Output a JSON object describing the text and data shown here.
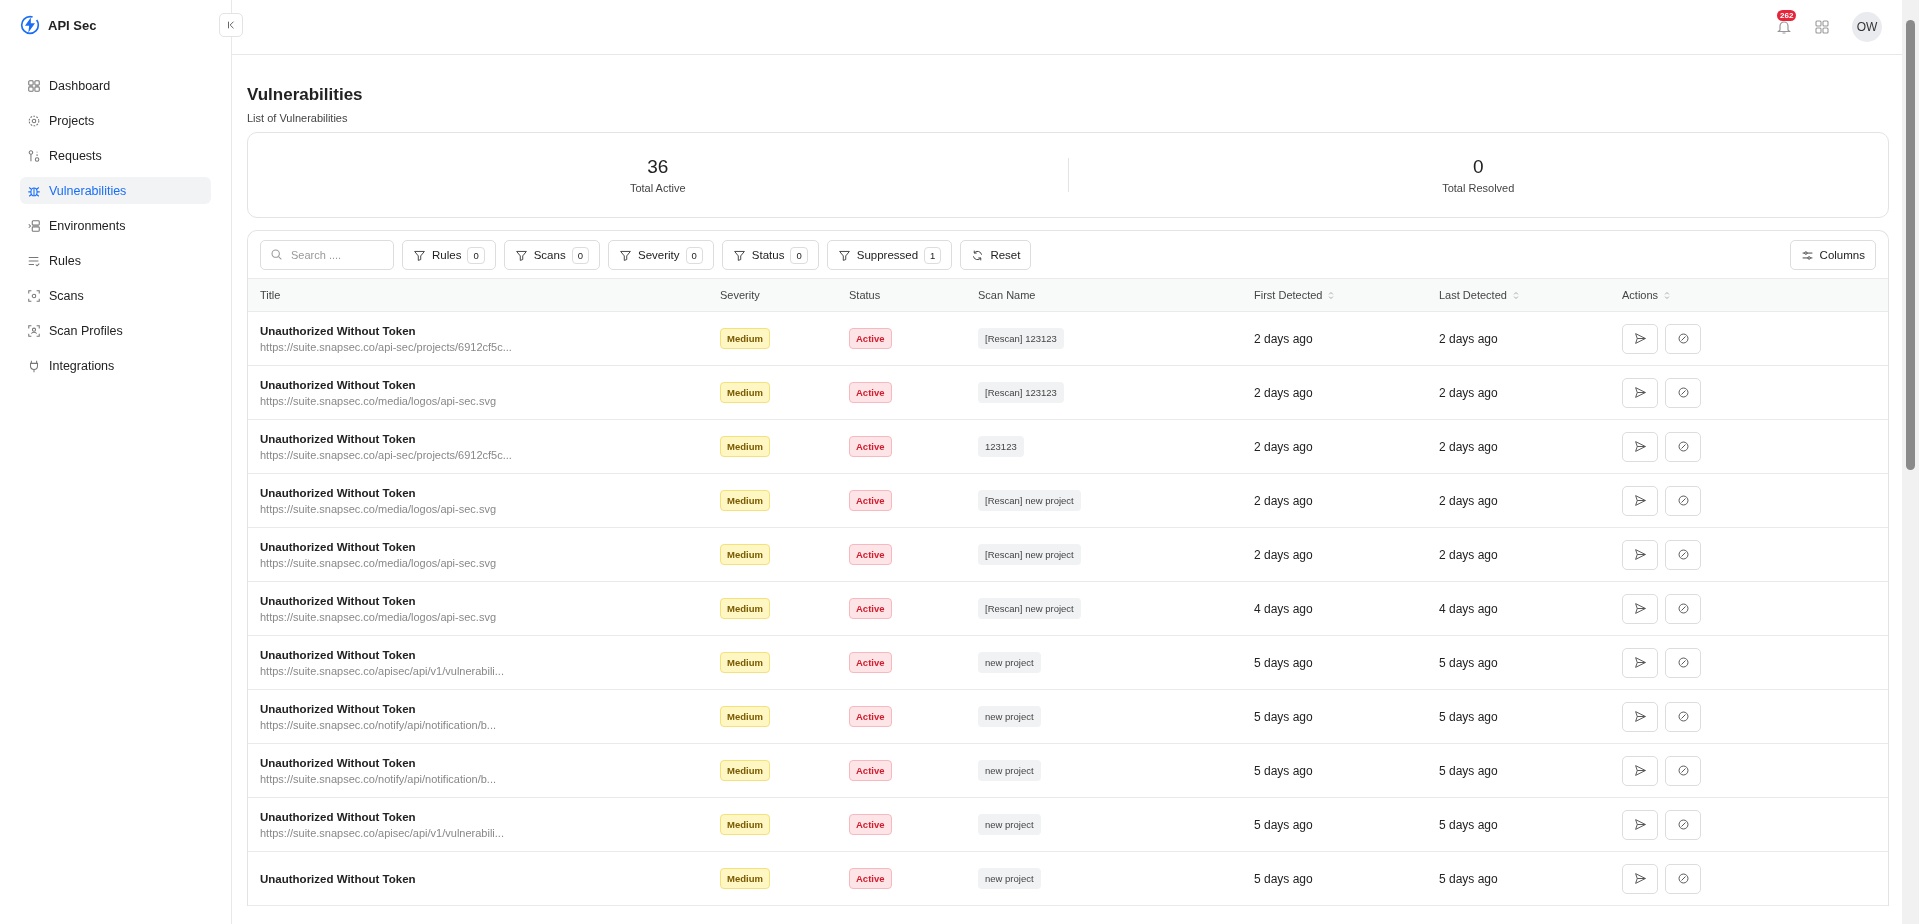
{
  "brand": {
    "name": "API Sec"
  },
  "sidebar": {
    "items": [
      {
        "label": "Dashboard",
        "selected": false
      },
      {
        "label": "Projects",
        "selected": false
      },
      {
        "label": "Requests",
        "selected": false
      },
      {
        "label": "Vulnerabilities",
        "selected": true
      },
      {
        "label": "Environments",
        "selected": false
      },
      {
        "label": "Rules",
        "selected": false
      },
      {
        "label": "Scans",
        "selected": false
      },
      {
        "label": "Scan Profiles",
        "selected": false
      },
      {
        "label": "Integrations",
        "selected": false
      }
    ]
  },
  "header": {
    "notification_count": "262",
    "avatar": "OW"
  },
  "page": {
    "title": "Vulnerabilities",
    "subtitle": "List of Vulnerabilities"
  },
  "stats": [
    {
      "value": "36",
      "label": "Total Active"
    },
    {
      "value": "0",
      "label": "Total Resolved"
    }
  ],
  "toolbar": {
    "search_placeholder": "Search ....",
    "filters": [
      {
        "label": "Rules",
        "count": "0"
      },
      {
        "label": "Scans",
        "count": "0"
      },
      {
        "label": "Severity",
        "count": "0"
      },
      {
        "label": "Status",
        "count": "0"
      },
      {
        "label": "Suppressed",
        "count": "1"
      }
    ],
    "reset": "Reset",
    "columns": "Columns"
  },
  "table": {
    "columns": [
      {
        "label": "Title",
        "sortable": false
      },
      {
        "label": "Severity",
        "sortable": false
      },
      {
        "label": "Status",
        "sortable": false
      },
      {
        "label": "Scan Name",
        "sortable": false
      },
      {
        "label": "First Detected",
        "sortable": true
      },
      {
        "label": "Last Detected",
        "sortable": true
      },
      {
        "label": "Actions",
        "sortable": true
      }
    ],
    "rows": [
      {
        "title": "Unauthorized Without Token",
        "url": "https://suite.snapsec.co/api-sec/projects/6912cf5c...",
        "severity": "Medium",
        "status": "Active",
        "scan": "[Rescan] 123123",
        "first": "2 days ago",
        "last": "2 days ago"
      },
      {
        "title": "Unauthorized Without Token",
        "url": "https://suite.snapsec.co/media/logos/api-sec.svg",
        "severity": "Medium",
        "status": "Active",
        "scan": "[Rescan] 123123",
        "first": "2 days ago",
        "last": "2 days ago"
      },
      {
        "title": "Unauthorized Without Token",
        "url": "https://suite.snapsec.co/api-sec/projects/6912cf5c...",
        "severity": "Medium",
        "status": "Active",
        "scan": "123123",
        "first": "2 days ago",
        "last": "2 days ago"
      },
      {
        "title": "Unauthorized Without Token",
        "url": "https://suite.snapsec.co/media/logos/api-sec.svg",
        "severity": "Medium",
        "status": "Active",
        "scan": "[Rescan] new project",
        "first": "2 days ago",
        "last": "2 days ago"
      },
      {
        "title": "Unauthorized Without Token",
        "url": "https://suite.snapsec.co/media/logos/api-sec.svg",
        "severity": "Medium",
        "status": "Active",
        "scan": "[Rescan] new project",
        "first": "2 days ago",
        "last": "2 days ago"
      },
      {
        "title": "Unauthorized Without Token",
        "url": "https://suite.snapsec.co/media/logos/api-sec.svg",
        "severity": "Medium",
        "status": "Active",
        "scan": "[Rescan] new project",
        "first": "4 days ago",
        "last": "4 days ago"
      },
      {
        "title": "Unauthorized Without Token",
        "url": "https://suite.snapsec.co/apisec/api/v1/vulnerabili...",
        "severity": "Medium",
        "status": "Active",
        "scan": "new project",
        "first": "5 days ago",
        "last": "5 days ago"
      },
      {
        "title": "Unauthorized Without Token",
        "url": "https://suite.snapsec.co/notify/api/notification/b...",
        "severity": "Medium",
        "status": "Active",
        "scan": "new project",
        "first": "5 days ago",
        "last": "5 days ago"
      },
      {
        "title": "Unauthorized Without Token",
        "url": "https://suite.snapsec.co/notify/api/notification/b...",
        "severity": "Medium",
        "status": "Active",
        "scan": "new project",
        "first": "5 days ago",
        "last": "5 days ago"
      },
      {
        "title": "Unauthorized Without Token",
        "url": "https://suite.snapsec.co/apisec/api/v1/vulnerabili...",
        "severity": "Medium",
        "status": "Active",
        "scan": "new project",
        "first": "5 days ago",
        "last": "5 days ago"
      },
      {
        "title": "Unauthorized Without Token",
        "severity": "Medium",
        "status": "Active",
        "scan": "new project",
        "first": "5 days ago",
        "last": "5 days ago"
      }
    ]
  }
}
